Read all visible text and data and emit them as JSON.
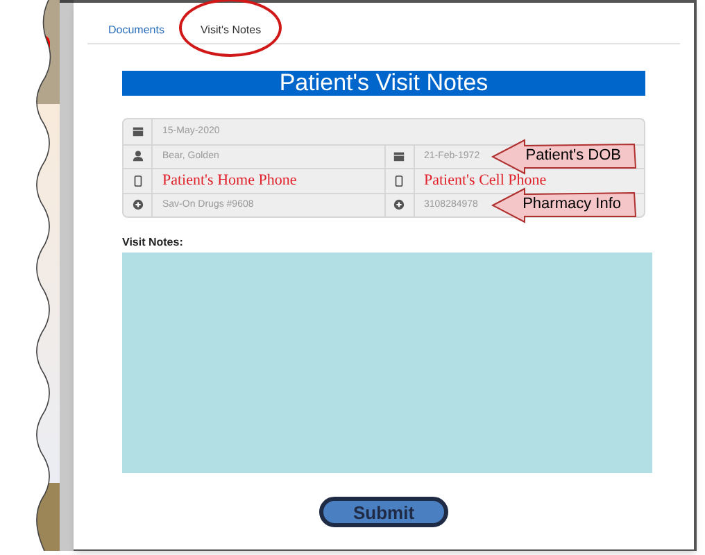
{
  "tabs": [
    {
      "label": "Documents",
      "selected": false,
      "circled": false
    },
    {
      "label": "Visit's Notes",
      "selected": true,
      "circled": true
    }
  ],
  "title": "Patient's Visit Notes",
  "form_rows": [
    {
      "fields": [
        {
          "kind": "date",
          "value": "15-May-2020",
          "annotation": false
        }
      ]
    },
    {
      "fields": [
        {
          "kind": "person",
          "value": "Bear, Golden",
          "annotation": false
        },
        {
          "kind": "date",
          "value": "21-Feb-1972",
          "annotation": false,
          "callout": "Patient's DOB"
        }
      ]
    },
    {
      "fields": [
        {
          "kind": "phone",
          "value": "Patient's Home Phone",
          "annotation": true
        },
        {
          "kind": "phone",
          "value": "Patient's Cell Phone",
          "annotation": true
        }
      ]
    },
    {
      "fields": [
        {
          "kind": "pharmacy",
          "value": "Sav-On Drugs #9608",
          "annotation": false
        },
        {
          "kind": "pharmacy",
          "value": "3108284978",
          "annotation": false,
          "callout": "Pharmacy Info"
        }
      ]
    }
  ],
  "notes_label": "Visit Notes:",
  "submit": "Submit"
}
